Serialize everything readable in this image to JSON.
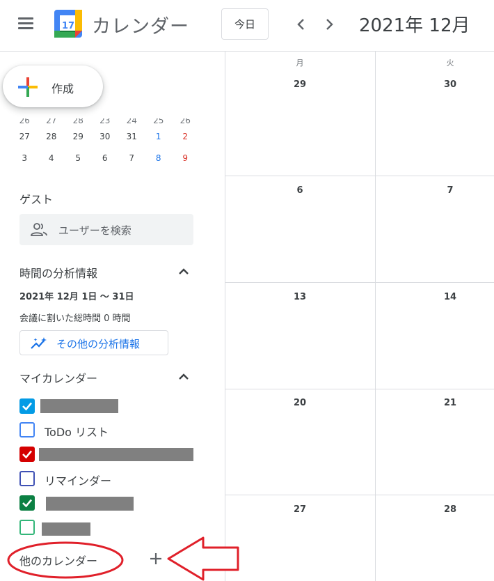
{
  "header": {
    "app_title": "カレンダー",
    "logo_day": "17",
    "today_label": "今日",
    "month_title": "2021年 12月"
  },
  "sidebar": {
    "create_label": "作成",
    "mini_calendar": {
      "partial_row": [
        "26",
        "27",
        "28",
        "23",
        "24",
        "25",
        "26"
      ],
      "rows": [
        [
          "27",
          "28",
          "29",
          "30",
          "31",
          "1",
          "2"
        ],
        [
          "3",
          "4",
          "5",
          "6",
          "7",
          "8",
          "9"
        ]
      ]
    },
    "guest": {
      "title": "ゲスト",
      "search_placeholder": "ユーザーを検索"
    },
    "insights": {
      "title": "時間の分析情報",
      "range": "2021年 12月 1日 〜 31日",
      "total": "会議に割いた総時間 0 時間",
      "more_label": "その他の分析情報"
    },
    "my_calendars": {
      "title": "マイカレンダー",
      "items": [
        {
          "label": "",
          "checked": true,
          "color": "#039be5"
        },
        {
          "label": "ToDo リスト",
          "checked": false,
          "color": "#4285f4"
        },
        {
          "label": "",
          "checked": true,
          "color": "#d50000"
        },
        {
          "label": "リマインダー",
          "checked": false,
          "color": "#3f51b5"
        },
        {
          "label": "",
          "checked": true,
          "color": "#0b8043"
        },
        {
          "label": "",
          "checked": false,
          "color": "#33b679"
        }
      ]
    },
    "other_calendars": {
      "title": "他のカレンダー"
    }
  },
  "grid": {
    "weekdays": [
      "月",
      "火"
    ],
    "weeks": [
      [
        "29",
        "30"
      ],
      [
        "6",
        "7"
      ],
      [
        "13",
        "14"
      ],
      [
        "20",
        "21"
      ],
      [
        "27",
        "28"
      ]
    ]
  },
  "colors": {
    "accent": "#1a73e8",
    "annotation": "#e0202a"
  }
}
